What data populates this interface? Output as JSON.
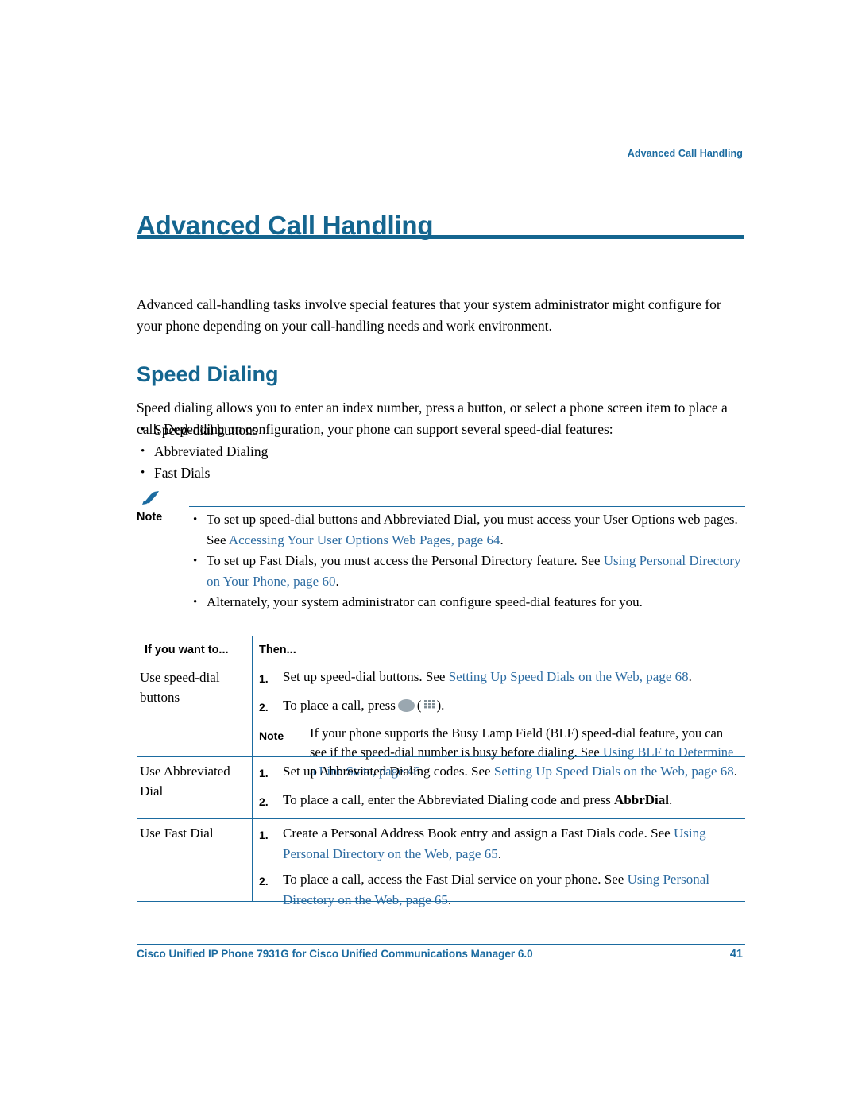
{
  "running_head": "Advanced Call Handling",
  "chapter_title": "Advanced Call Handling",
  "intro": "Advanced call-handling tasks involve special features that your system administrator might configure for your phone depending on your call-handling needs and work environment.",
  "section": {
    "heading": "Speed Dialing",
    "body": "Speed dialing allows you to enter an index number, press a button, or select a phone screen item to place a call. Depending on configuration, your phone can support several speed-dial features:",
    "bullets": [
      "Speed-dial buttons",
      "Abbreviated Dialing",
      "Fast Dials"
    ]
  },
  "note": {
    "label": "Note",
    "bullets": [
      {
        "pre": "To set up speed-dial buttons and Abbreviated Dial, you must access your User Options web pages. See ",
        "link": "Accessing Your User Options Web Pages, page 64",
        "post": "."
      },
      {
        "pre": "To set up Fast Dials, you must access the Personal Directory feature. See ",
        "link": "Using Personal Directory on Your Phone, page 60",
        "post": "."
      },
      {
        "pre": "Alternately, your system administrator can configure speed-dial features for you.",
        "link": "",
        "post": ""
      }
    ]
  },
  "table": {
    "headers": [
      "If you want to...",
      "Then..."
    ],
    "rows": [
      {
        "label": "Use speed-dial buttons",
        "steps": [
          {
            "num": "1.",
            "pre": "Set up speed-dial buttons. See ",
            "link": "Setting Up Speed Dials on the Web, page 68",
            "post": "."
          },
          {
            "num": "2.",
            "pre": "To place a call, press",
            "link": "",
            "post": ").",
            "icons": [
              "line-button-icon",
              "keypad-icon"
            ]
          }
        ],
        "inner_note": {
          "label": "Note",
          "pre": "If your phone supports the Busy Lamp Field (BLF) speed-dial feature, you can see if the speed-dial number is busy before dialing. See ",
          "link": "Using BLF to Determine a Line State, page 46",
          "post": "."
        }
      },
      {
        "label": "Use Abbreviated Dial",
        "steps": [
          {
            "num": "1.",
            "pre": "Set up Abbreviated Dialing codes. See ",
            "link": "Setting Up Speed Dials on the Web, page 68",
            "post": "."
          },
          {
            "num": "2.",
            "pre": "To place a call, enter the Abbreviated Dialing code and press ",
            "bold": "AbbrDial",
            "link": "",
            "post": "."
          }
        ]
      },
      {
        "label": "Use Fast Dial",
        "steps": [
          {
            "num": "1.",
            "pre": "Create a Personal Address Book entry and assign a Fast Dials code. See ",
            "link": "Using Personal Directory on the Web, page 65",
            "post": "."
          },
          {
            "num": "2.",
            "pre": "To place a call, access the Fast Dial service on your phone. See ",
            "link": "Using Personal Directory on the Web, page 65",
            "post": "."
          }
        ]
      }
    ]
  },
  "footer": {
    "text": "Cisco Unified IP Phone 7931G for Cisco Unified Communications Manager 6.0",
    "page": "41"
  }
}
